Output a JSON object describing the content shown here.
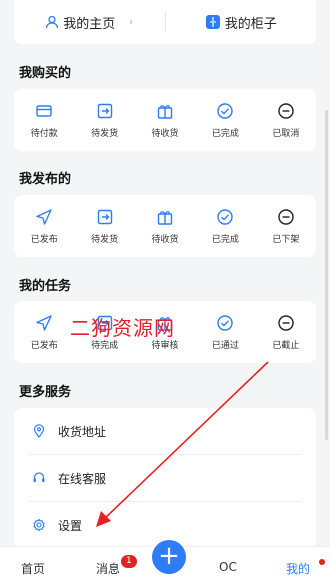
{
  "top_links": {
    "home_label": "我的主页",
    "cabinet_label": "我的柜子",
    "chevron": "›"
  },
  "sections": [
    {
      "title": "我购买的",
      "items": [
        "待付款",
        "待发货",
        "待收货",
        "已完成",
        "已取消"
      ]
    },
    {
      "title": "我发布的",
      "items": [
        "已发布",
        "待发货",
        "待收货",
        "已完成",
        "已下架"
      ]
    },
    {
      "title": "我的任务",
      "items": [
        "已发布",
        "待完成",
        "待审核",
        "已通过",
        "已截止"
      ]
    }
  ],
  "more_services": {
    "title": "更多服务",
    "items": [
      {
        "label": "收货地址",
        "icon": "location-icon"
      },
      {
        "label": "在线客服",
        "icon": "headset-icon"
      },
      {
        "label": "设置",
        "icon": "gear-icon"
      }
    ]
  },
  "watermark": "二狗资源网",
  "tabbar": {
    "home": "首页",
    "messages": "消息",
    "messages_badge": "1",
    "oc": "OC",
    "mine": "我的",
    "add": "+"
  },
  "colors": {
    "accent": "#2f7df6",
    "badge": "#e02424"
  }
}
